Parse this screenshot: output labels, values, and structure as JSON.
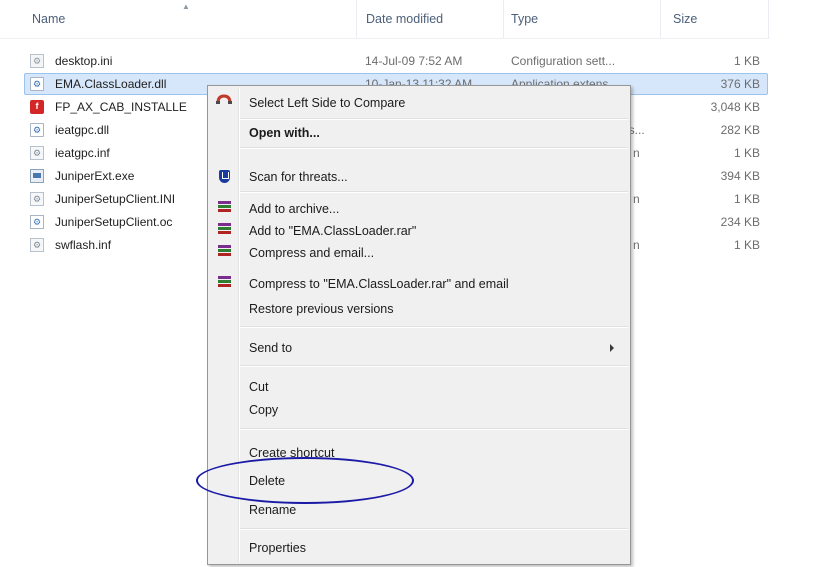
{
  "columns": {
    "name": "Name",
    "date_modified": "Date modified",
    "type": "Type",
    "size": "Size"
  },
  "files": [
    {
      "name": "desktop.ini",
      "date": "14-Jul-09 7:52 AM",
      "type": "Configuration sett...",
      "size": "1 KB",
      "icon": "ini-file-icon"
    },
    {
      "name": "EMA.ClassLoader.dll",
      "date": "10-Jan-13 11:32 AM",
      "type": "Application extens...",
      "size": "376 KB",
      "icon": "dll-file-icon"
    },
    {
      "name": "FP_AX_CAB_INSTALLE",
      "date": "",
      "type": "",
      "size": "3,048 KB",
      "icon": "flash-file-icon"
    },
    {
      "name": "ieatgpc.dll",
      "date": "",
      "type": "ns...",
      "size": "282 KB",
      "icon": "dll-file-icon"
    },
    {
      "name": "ieatgpc.inf",
      "date": "",
      "type": "n",
      "size": "1 KB",
      "icon": "inf-file-icon"
    },
    {
      "name": "JuniperExt.exe",
      "date": "",
      "type": "",
      "size": "394 KB",
      "icon": "exe-file-icon"
    },
    {
      "name": "JuniperSetupClient.INI",
      "date": "",
      "type": "n",
      "size": "1 KB",
      "icon": "inf-file-icon"
    },
    {
      "name": "JuniperSetupClient.oc",
      "date": "",
      "type": "",
      "size": "234 KB",
      "icon": "ocx-file-icon"
    },
    {
      "name": "swflash.inf",
      "date": "",
      "type": "n",
      "size": "1 KB",
      "icon": "inf-file-icon"
    }
  ],
  "context_menu": {
    "select_left_side": "Select Left Side to Compare",
    "open_with": "Open with...",
    "scan_for_threats": "Scan for threats...",
    "add_to_archive": "Add to archive...",
    "add_to_rar": "Add to \"EMA.ClassLoader.rar\"",
    "compress_and_email": "Compress and email...",
    "compress_to_rar_email": "Compress to \"EMA.ClassLoader.rar\" and email",
    "restore_previous_versions": "Restore previous versions",
    "send_to": "Send to",
    "cut": "Cut",
    "copy": "Copy",
    "create_shortcut": "Create shortcut",
    "delete": "Delete",
    "rename": "Rename",
    "properties": "Properties"
  },
  "colors": {
    "selection_bg": "#d6e7fb",
    "highlight_ellipse": "#1a1aa6",
    "menu_bg": "#f0f0f0"
  }
}
